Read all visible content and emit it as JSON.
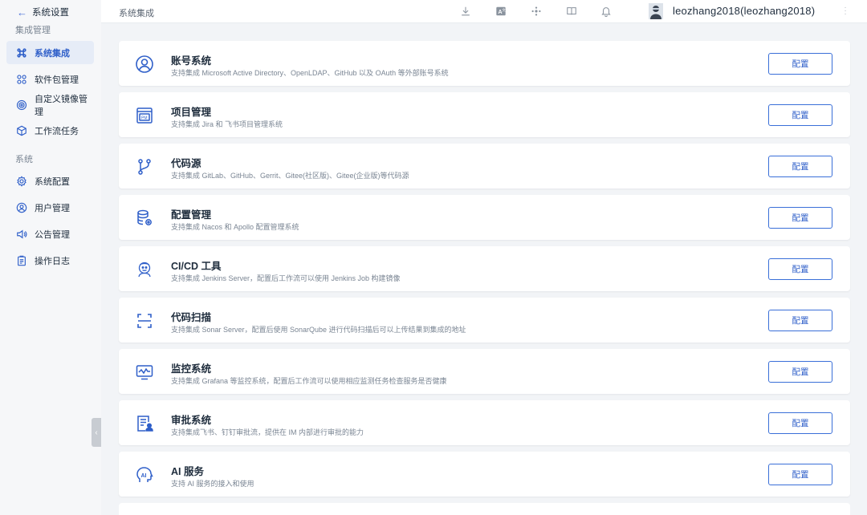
{
  "sidebar": {
    "back_label": "系统设置",
    "group1_label": "集成管理",
    "group1_items": [
      {
        "label": "系统集成",
        "icon": "command-icon",
        "active": true
      },
      {
        "label": "软件包管理",
        "icon": "grid-icon",
        "active": false
      },
      {
        "label": "自定义镜像管理",
        "icon": "target-icon",
        "active": false
      },
      {
        "label": "工作流任务",
        "icon": "cube-icon",
        "active": false
      }
    ],
    "group2_label": "系统",
    "group2_items": [
      {
        "label": "系统配置",
        "icon": "gear-icon",
        "active": false
      },
      {
        "label": "用户管理",
        "icon": "user-icon",
        "active": false
      },
      {
        "label": "公告管理",
        "icon": "speaker-icon",
        "active": false
      },
      {
        "label": "操作日志",
        "icon": "clipboard-icon",
        "active": false
      }
    ]
  },
  "header": {
    "breadcrumb": "系统集成",
    "icons": [
      "download-icon",
      "translate-icon",
      "plugin-icon",
      "book-icon",
      "bell-icon"
    ],
    "username": "leozhang2018(leozhang2018)"
  },
  "colors": {
    "accent": "#2f5fc9",
    "background": "#f2f4f7"
  },
  "integrations": [
    {
      "title": "账号系统",
      "description": "支持集成 Microsoft Active Directory、OpenLDAP、GitHub 以及 OAuth 等外部账号系统",
      "button": "配置",
      "icon": "account-icon"
    },
    {
      "title": "项目管理",
      "description": "支持集成 Jira 和 飞书项目管理系统",
      "button": "配置",
      "icon": "project-management-icon"
    },
    {
      "title": "代码源",
      "description": "支持集成 GitLab、GitHub、Gerrit、Gitee(社区版)、Gitee(企业版)等代码源",
      "button": "配置",
      "icon": "git-branch-icon"
    },
    {
      "title": "配置管理",
      "description": "支持集成 Nacos 和 Apollo 配置管理系统",
      "button": "配置",
      "icon": "database-settings-icon"
    },
    {
      "title": "CI/CD 工具",
      "description": "支持集成 Jenkins Server，配置后工作流可以使用 Jenkins Job 构建镜像",
      "button": "配置",
      "icon": "jenkins-icon"
    },
    {
      "title": "代码扫描",
      "description": "支持集成 Sonar Server，配置后使用 SonarQube 进行代码扫描后可以上传结果到集成的地址",
      "button": "配置",
      "icon": "scan-icon"
    },
    {
      "title": "监控系统",
      "description": "支持集成 Grafana 等监控系统，配置后工作流可以使用相应监测任务检查服务是否健康",
      "button": "配置",
      "icon": "monitor-icon"
    },
    {
      "title": "审批系统",
      "description": "支持集成飞书、钉钉审批流，提供在 IM 内部进行审批的能力",
      "button": "配置",
      "icon": "approval-icon"
    },
    {
      "title": "AI 服务",
      "description": "支持 AI 服务的接入和使用",
      "button": "配置",
      "icon": "ai-icon"
    }
  ]
}
